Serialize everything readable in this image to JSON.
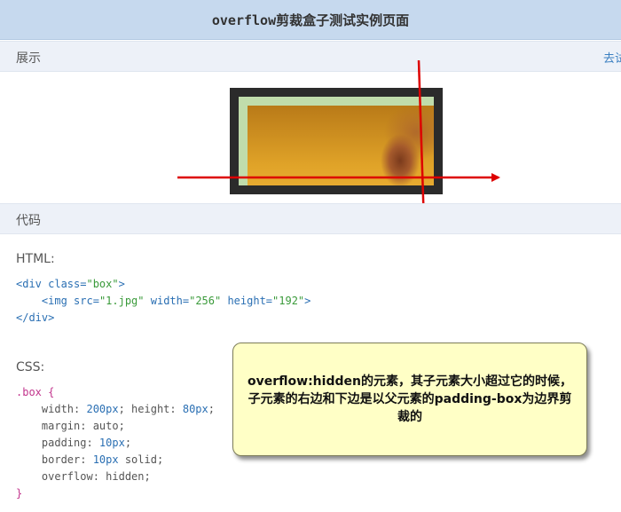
{
  "page": {
    "title": "overflow剪裁盒子测试实例页面"
  },
  "demo_section": {
    "label": "展示",
    "right_link": "去试"
  },
  "code_section": {
    "label": "代码",
    "html_label": "HTML:",
    "html_lines": {
      "l1_open": "<div ",
      "l1_attr": "class=",
      "l1_val": "\"box\"",
      "l1_close": ">",
      "l2_open": "    <img ",
      "l2_a1": "src=",
      "l2_v1": "\"1.jpg\"",
      "l2_a2": " width=",
      "l2_v2": "\"256\"",
      "l2_a3": " height=",
      "l2_v3": "\"192\"",
      "l2_close": ">",
      "l3": "</div>"
    },
    "css_label": "CSS:",
    "css_lines": {
      "selector": ".box {",
      "l1_prop": "    width: ",
      "l1_v1": "200px",
      "l1_mid": "; height: ",
      "l1_v2": "80px",
      "l1_end": ";",
      "l2": "    margin: auto;",
      "l3_prop": "    padding: ",
      "l3_v": "10px",
      "l3_end": ";",
      "l4_prop": "    border: ",
      "l4_v": "10px",
      "l4_end": " solid;",
      "l5": "    overflow: hidden;",
      "close": "}"
    }
  },
  "callout": {
    "text": "overflow:hidden的元素，其子元素大小超过它的时候，子元素的右边和下边是以父元素的padding-box为边界剪裁的"
  },
  "colors": {
    "title_bar": "#c6d9ee",
    "section_bar": "#edf1f8",
    "callout_bg": "#ffffc6",
    "arrow": "#dd0000",
    "box_border": "#2b2b2b",
    "box_padding": "#c0dcab"
  }
}
